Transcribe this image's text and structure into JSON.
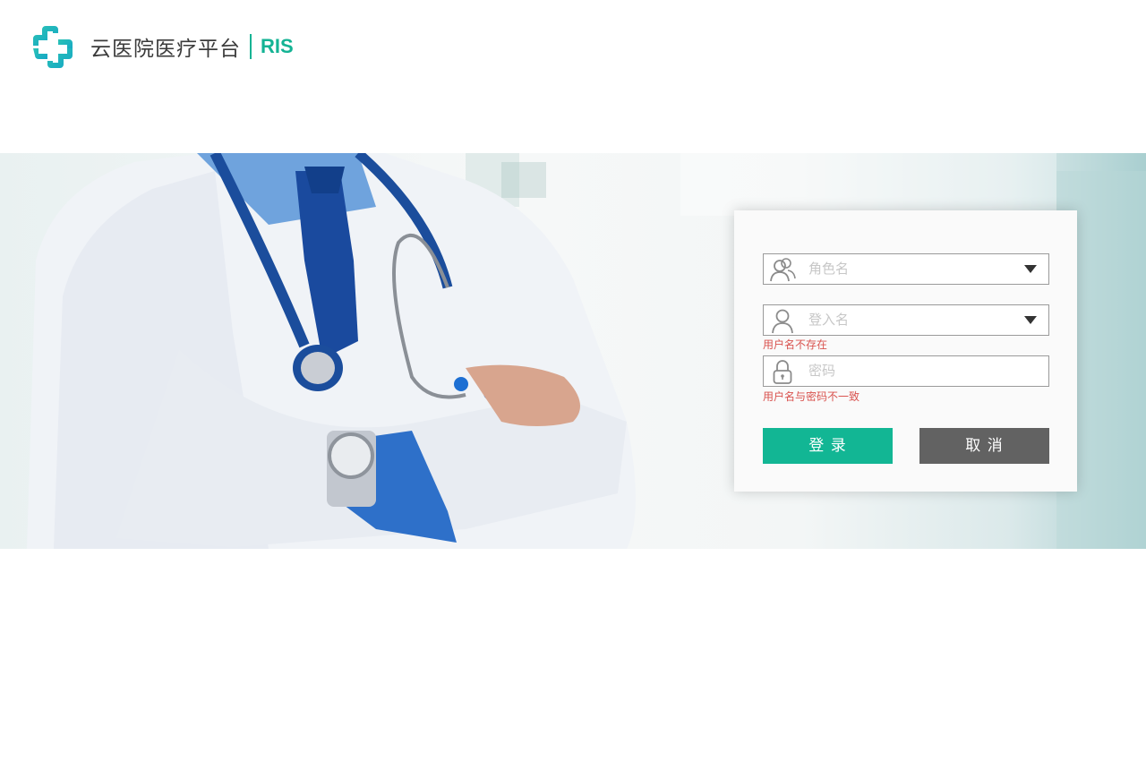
{
  "header": {
    "app_title": "云医院医疗平台",
    "app_suffix": "RIS"
  },
  "login": {
    "role_field": {
      "placeholder": "角色名",
      "icon": "users-icon"
    },
    "login_field": {
      "placeholder": "登入名",
      "icon": "user-icon"
    },
    "password_field": {
      "placeholder": "密码",
      "icon": "lock-icon"
    },
    "errors": {
      "username": "用户名不存在",
      "password": "用户名与密码不一致"
    },
    "buttons": {
      "login": "登  录",
      "cancel": "取  消"
    }
  },
  "colors": {
    "brand": "#14b394",
    "login_button": "#12b694",
    "cancel_button": "#626262",
    "error_text": "#d9534f"
  }
}
